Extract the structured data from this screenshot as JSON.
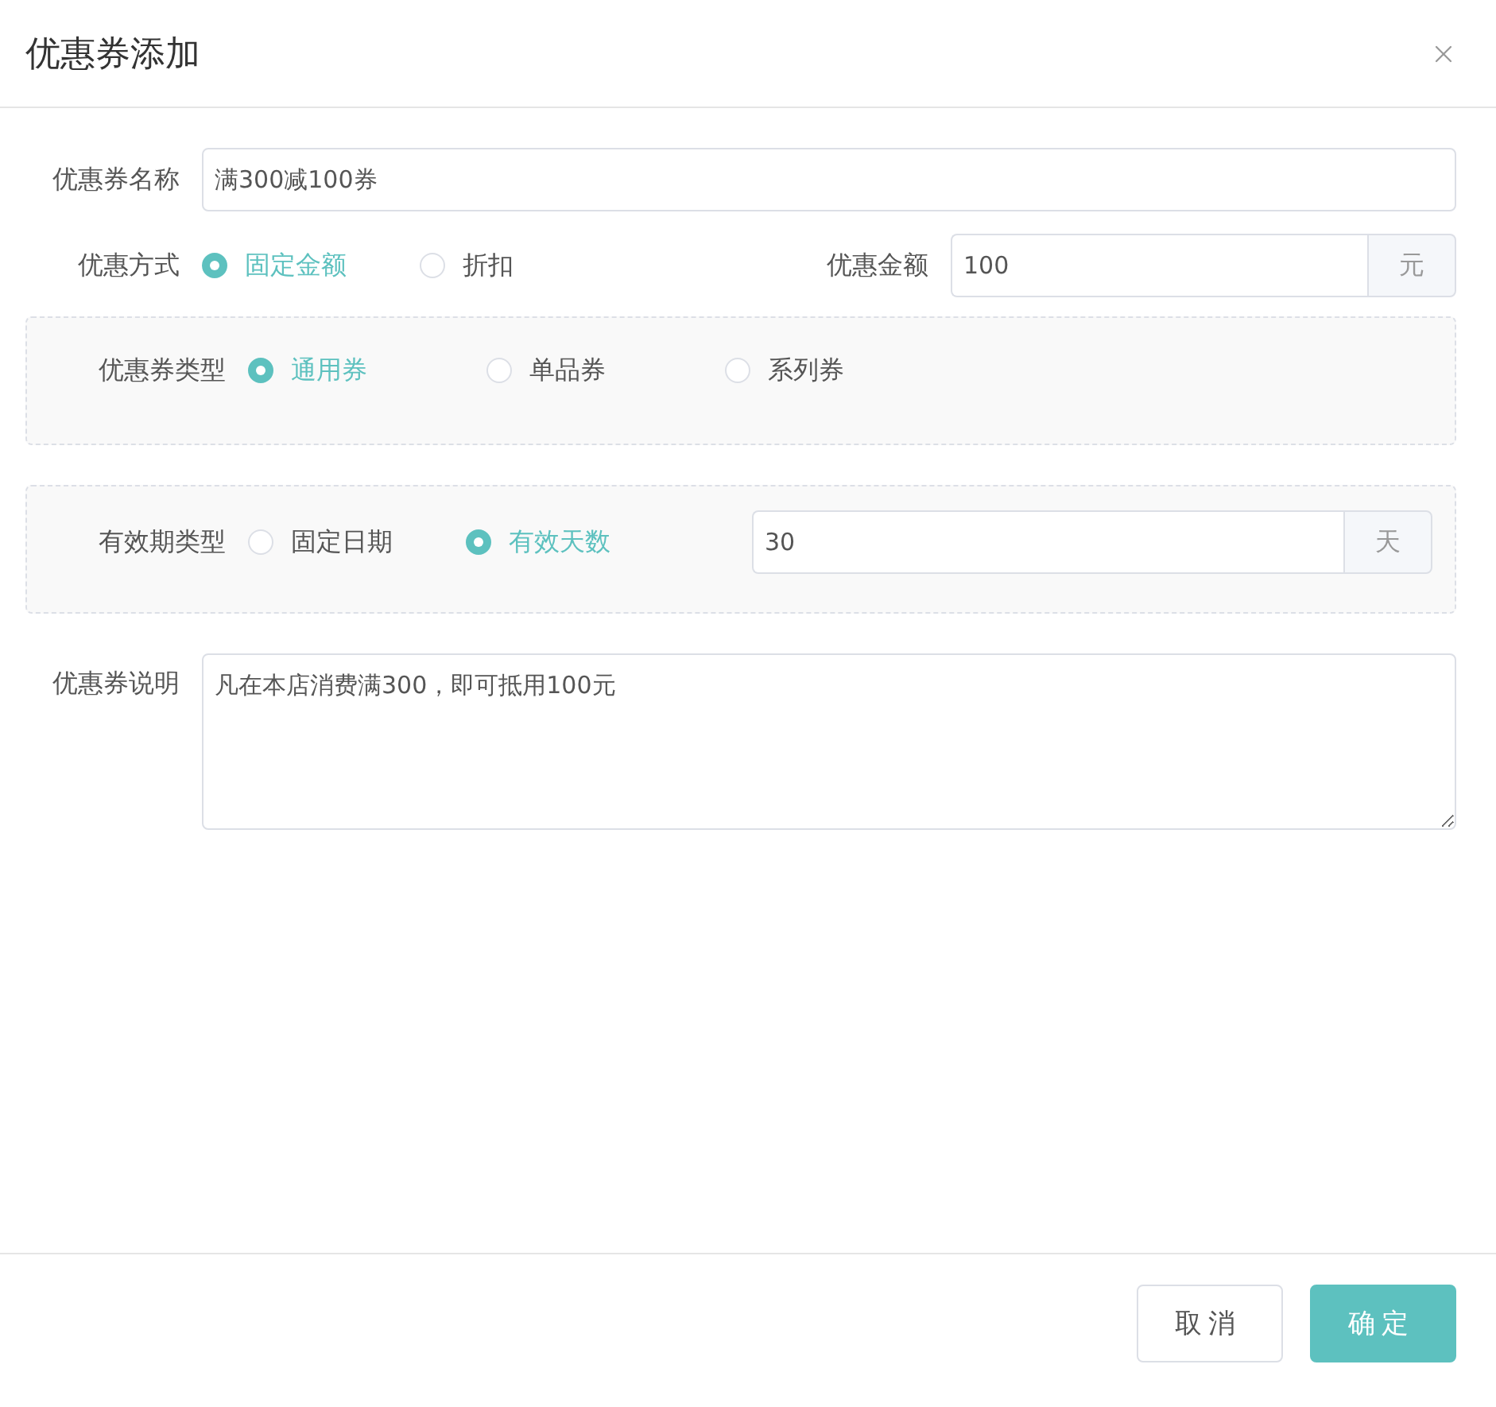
{
  "dialog": {
    "title": "优惠券添加"
  },
  "name_field": {
    "label": "优惠券名称",
    "value": "满300减100券"
  },
  "discount_method": {
    "label": "优惠方式",
    "options": [
      {
        "label": "固定金额",
        "selected": true
      },
      {
        "label": "折扣",
        "selected": false
      }
    ]
  },
  "discount_amount": {
    "label": "优惠金额",
    "value": "100",
    "unit": "元"
  },
  "coupon_type": {
    "label": "优惠券类型",
    "options": [
      {
        "label": "通用券",
        "selected": true
      },
      {
        "label": "单品券",
        "selected": false
      },
      {
        "label": "系列券",
        "selected": false
      }
    ]
  },
  "validity_type": {
    "label": "有效期类型",
    "options": [
      {
        "label": "固定日期",
        "selected": false
      },
      {
        "label": "有效天数",
        "selected": true
      }
    ]
  },
  "validity_days": {
    "value": "30",
    "unit": "天"
  },
  "description": {
    "label": "优惠券说明",
    "value": "凡在本店消费满300，即可抵用100元"
  },
  "buttons": [
    {
      "label": "取消",
      "kind": "secondary"
    },
    {
      "label": "确定",
      "kind": "primary"
    }
  ]
}
